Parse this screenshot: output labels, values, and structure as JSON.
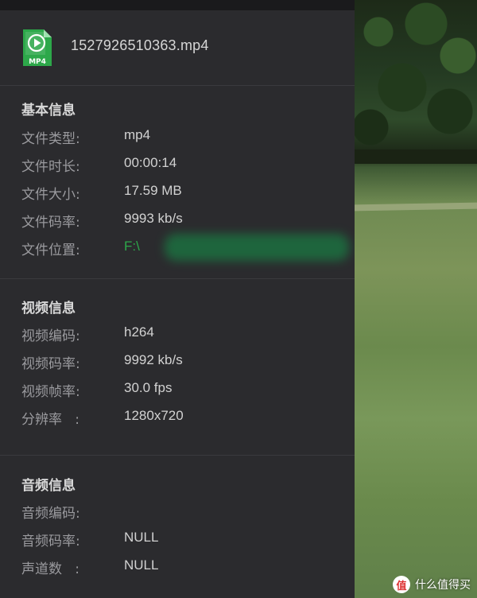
{
  "file": {
    "icon": "mp4-file-icon",
    "icon_label": "MP4",
    "name": "1527926510363.mp4",
    "accent_color": "#2da84a"
  },
  "basic": {
    "title": "基本信息",
    "rows": [
      {
        "label": "文件类型:",
        "value": "mp4"
      },
      {
        "label": "文件时长:",
        "value": "00:00:14"
      },
      {
        "label": "文件大小:",
        "value": "17.59 MB"
      },
      {
        "label": "文件码率:",
        "value": "9993 kb/s"
      },
      {
        "label": "文件位置:",
        "value": "F:\\"
      }
    ]
  },
  "video": {
    "title": "视频信息",
    "rows": [
      {
        "label": "视频编码:",
        "value": "h264"
      },
      {
        "label": "视频码率:",
        "value": "9992 kb/s"
      },
      {
        "label": "视频帧率:",
        "value": "30.0 fps"
      },
      {
        "label": "分辨率   :",
        "value": "1280x720"
      }
    ]
  },
  "audio": {
    "title": "音频信息",
    "rows": [
      {
        "label": "音频编码:",
        "value": ""
      },
      {
        "label": "音频码率:",
        "value": "NULL"
      },
      {
        "label": "声道数   :",
        "value": "NULL"
      }
    ]
  },
  "watermark": {
    "badge": "值",
    "text": "什么值得买"
  }
}
